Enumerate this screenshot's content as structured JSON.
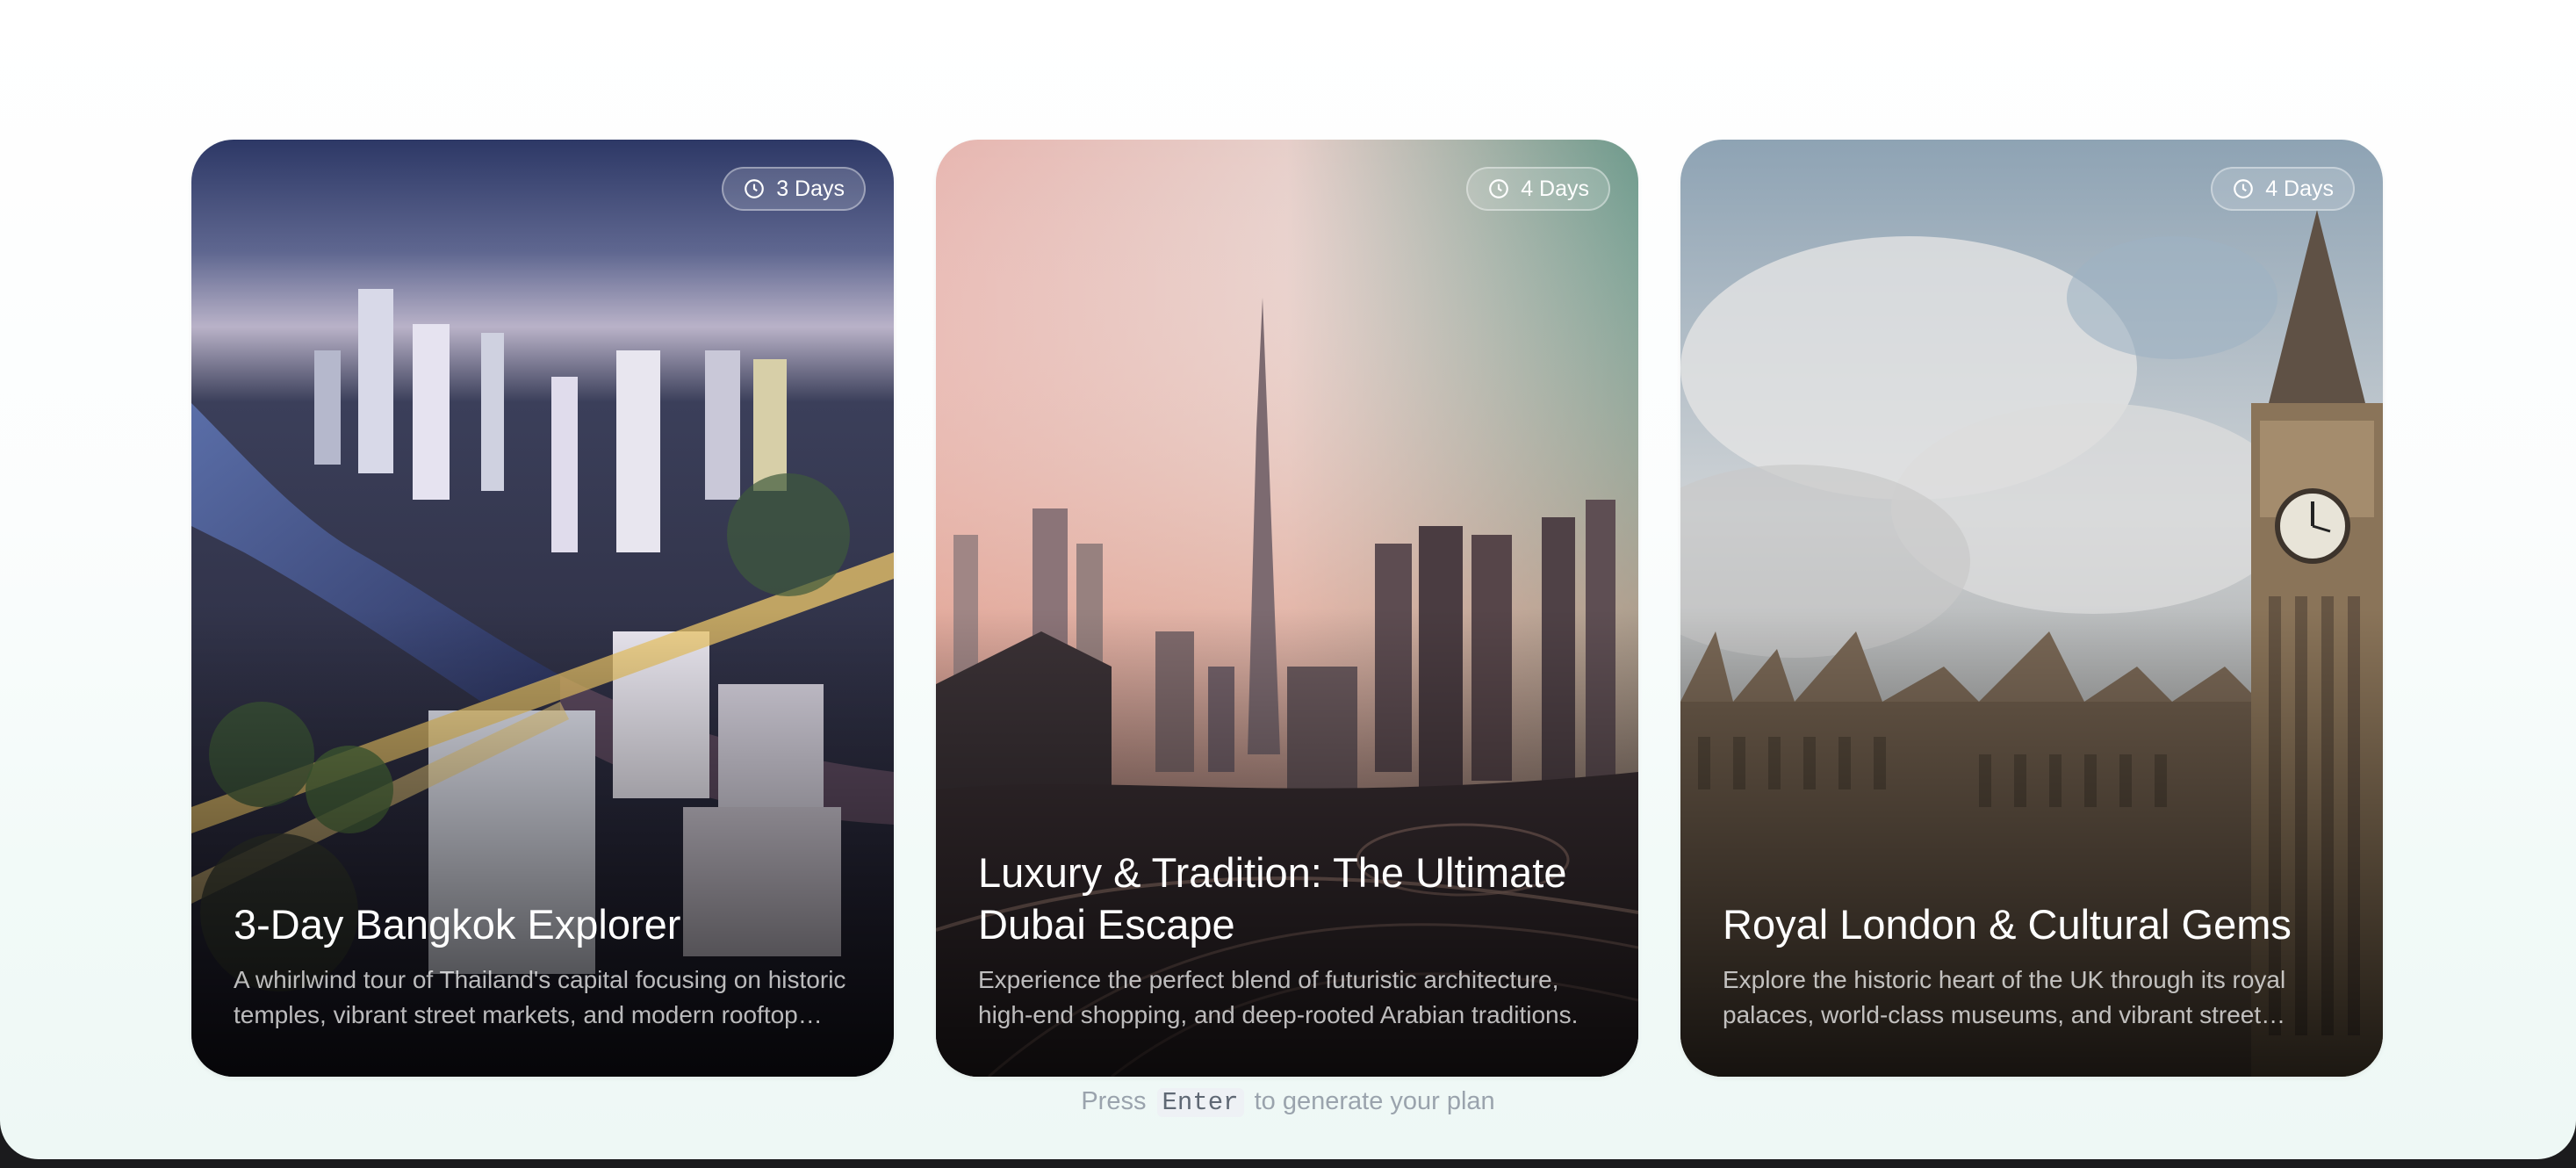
{
  "hint": {
    "prefix": "Press",
    "key": "Enter",
    "suffix": "to generate your plan"
  },
  "cards": [
    {
      "duration": "3 Days",
      "title": "3-Day Bangkok Explorer",
      "description": "A whirlwind tour of Thailand's capital focusing on historic temples, vibrant street markets, and modern rooftop views."
    },
    {
      "duration": "4 Days",
      "title": "Luxury & Tradition: The Ultimate Dubai Escape",
      "description": "Experience the perfect blend of futuristic architecture, high-end shopping, and deep-rooted Arabian traditions."
    },
    {
      "duration": "4 Days",
      "title": "Royal London & Cultural Gems",
      "description": "Explore the historic heart of the UK through its royal palaces, world-class museums, and vibrant street markets."
    }
  ],
  "colors": {
    "page_background": "#f2faf8",
    "hint_text": "#9aa3ad",
    "card_title": "#ffffff"
  },
  "icons": {
    "duration": "clock-icon"
  }
}
